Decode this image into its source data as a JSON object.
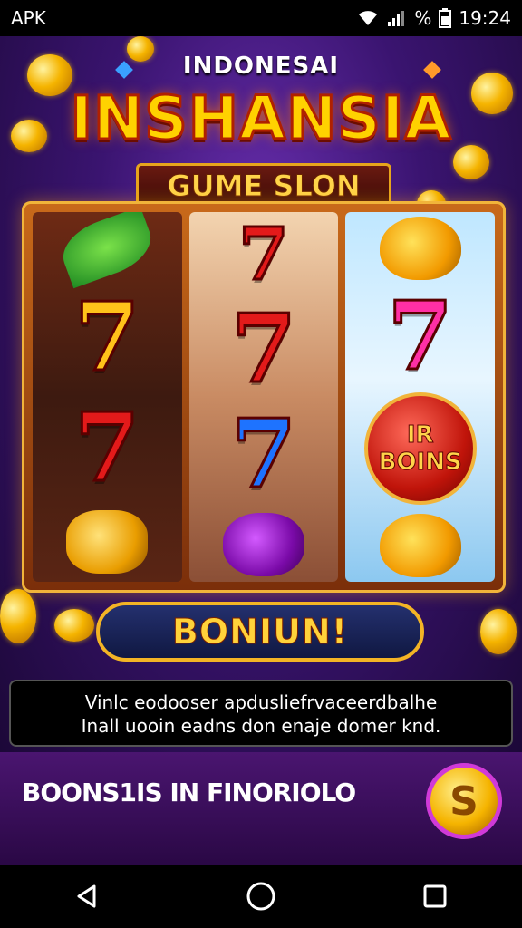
{
  "status_bar": {
    "app_label": "APK",
    "battery_percent_symbol": "%",
    "time": "19:24",
    "icons": [
      "wifi-icon",
      "signal-icon",
      "battery-icon"
    ]
  },
  "header": {
    "region": "INDONESAI",
    "title": "INSHANSIA",
    "subtitle": "GUME SLON"
  },
  "reels": {
    "reel_3_bonus_line1": "IR",
    "reel_3_bonus_line2": "BOINS",
    "symbols": [
      "leaf",
      "seven-gold",
      "seven-red",
      "fruit",
      "seven-red",
      "seven-red",
      "seven-blue",
      "plum",
      "swirl",
      "seven-pink",
      "bonus",
      "swirl"
    ]
  },
  "bonus_button": {
    "label": "BONIUN!"
  },
  "info": {
    "line1": "Vinlc eodooser apdusliefrvaceerdbalhe",
    "line2": "Inall uooin eadns don enaje domer knd."
  },
  "promo": {
    "label": "BOONS1IS IN FINORIOLO",
    "coin_symbol": "S"
  },
  "nav": {
    "icons": [
      "back-icon",
      "home-icon",
      "recents-icon"
    ]
  },
  "colors": {
    "title": "#ffd200",
    "accent_gold": "#f3b425",
    "background": "#3a1470",
    "promo_bg": "#4a1570"
  }
}
